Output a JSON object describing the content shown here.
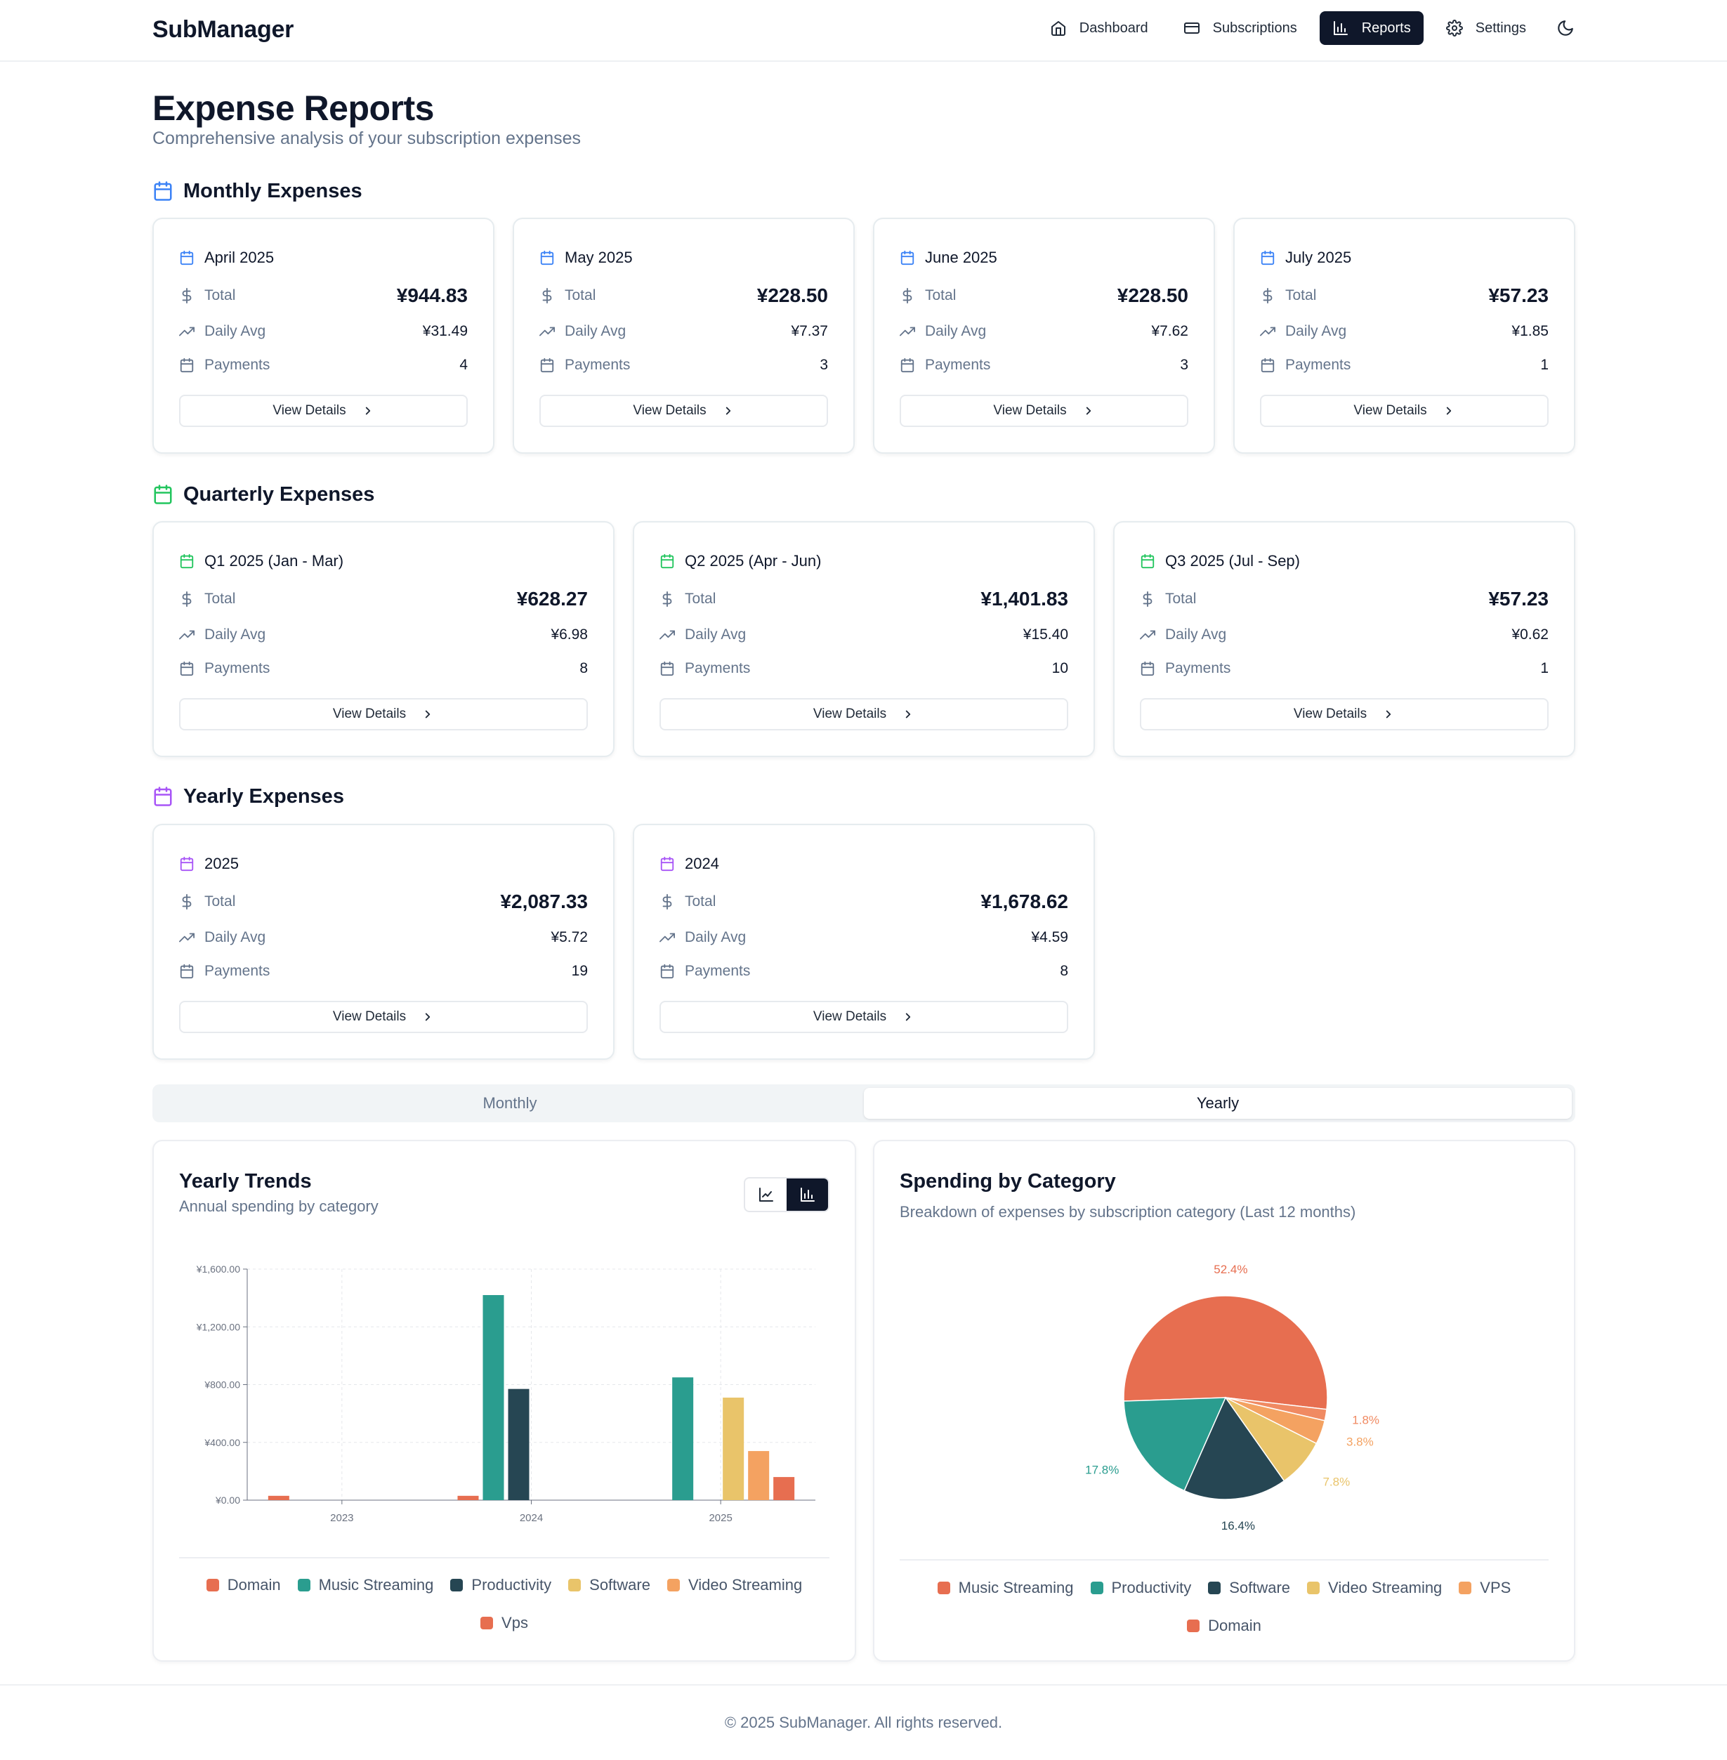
{
  "app": {
    "brand": "SubManager"
  },
  "nav": {
    "items": [
      {
        "label": "Dashboard",
        "icon": "home-icon"
      },
      {
        "label": "Subscriptions",
        "icon": "credit-card-icon"
      },
      {
        "label": "Reports",
        "icon": "bar-chart-icon",
        "active": true
      },
      {
        "label": "Settings",
        "icon": "gear-icon"
      }
    ],
    "theme_icon": "moon-icon"
  },
  "page": {
    "title": "Expense Reports",
    "subtitle": "Comprehensive analysis of your subscription expenses"
  },
  "labels": {
    "total": "Total",
    "daily_avg": "Daily Avg",
    "payments": "Payments",
    "view_details": "View Details"
  },
  "monthly": {
    "title": "Monthly Expenses",
    "accent": "#3b82f6",
    "cards": [
      {
        "period": "April 2025",
        "total": "¥944.83",
        "daily_avg": "¥31.49",
        "payments": "4"
      },
      {
        "period": "May 2025",
        "total": "¥228.50",
        "daily_avg": "¥7.37",
        "payments": "3"
      },
      {
        "period": "June 2025",
        "total": "¥228.50",
        "daily_avg": "¥7.62",
        "payments": "3"
      },
      {
        "period": "July 2025",
        "total": "¥57.23",
        "daily_avg": "¥1.85",
        "payments": "1"
      }
    ]
  },
  "quarterly": {
    "title": "Quarterly Expenses",
    "accent": "#22c55e",
    "cards": [
      {
        "period": "Q1 2025 (Jan - Mar)",
        "total": "¥628.27",
        "daily_avg": "¥6.98",
        "payments": "8"
      },
      {
        "period": "Q2 2025 (Apr - Jun)",
        "total": "¥1,401.83",
        "daily_avg": "¥15.40",
        "payments": "10"
      },
      {
        "period": "Q3 2025 (Jul - Sep)",
        "total": "¥57.23",
        "daily_avg": "¥0.62",
        "payments": "1"
      }
    ]
  },
  "yearly": {
    "title": "Yearly Expenses",
    "accent": "#a855f7",
    "cards": [
      {
        "period": "2025",
        "total": "¥2,087.33",
        "daily_avg": "¥5.72",
        "payments": "19"
      },
      {
        "period": "2024",
        "total": "¥1,678.62",
        "daily_avg": "¥4.59",
        "payments": "8"
      }
    ]
  },
  "tabs": [
    {
      "label": "Monthly",
      "active": false
    },
    {
      "label": "Yearly",
      "active": true
    }
  ],
  "trends": {
    "title": "Yearly Trends",
    "subtitle": "Annual spending by category",
    "toggle": [
      {
        "icon": "line-chart-icon",
        "active": false
      },
      {
        "icon": "bar-chart-icon",
        "active": true
      }
    ]
  },
  "category": {
    "title": "Spending by Category",
    "subtitle": "Breakdown of expenses by subscription category (Last 12 months)"
  },
  "colors": {
    "Domain": "#e76e50",
    "Music Streaming": "#2a9d8f",
    "Productivity": "#264653",
    "Software": "#e9c46a",
    "Video Streaming": "#f4a261",
    "Vps": "#e76e50"
  },
  "chart_data": [
    {
      "type": "bar",
      "categories": [
        "2023",
        "2024",
        "2025"
      ],
      "ylim": [
        0,
        1600
      ],
      "yticks": [
        "¥0.00",
        "¥400.00",
        "¥800.00",
        "¥1,200.00",
        "¥1,600.00"
      ],
      "series": [
        {
          "name": "Domain",
          "values": [
            30,
            30,
            0
          ]
        },
        {
          "name": "Music Streaming",
          "values": [
            0,
            1420,
            850
          ]
        },
        {
          "name": "Productivity",
          "values": [
            0,
            770,
            0
          ]
        },
        {
          "name": "Software",
          "values": [
            0,
            0,
            710
          ]
        },
        {
          "name": "Video Streaming",
          "values": [
            0,
            0,
            340
          ]
        },
        {
          "name": "Vps",
          "values": [
            0,
            0,
            160
          ]
        }
      ],
      "legend": [
        "Domain",
        "Music Streaming",
        "Productivity",
        "Software",
        "Video Streaming",
        "Vps"
      ],
      "grid": true,
      "legend_position": "bottom"
    },
    {
      "type": "pie",
      "slices": [
        {
          "name": "Music Streaming",
          "label": "52.4%",
          "value": 52.4,
          "color": "#e76e50"
        },
        {
          "name": "VPS",
          "label": "1.8%",
          "value": 1.8,
          "color": "#f08a62"
        },
        {
          "name": "Domain",
          "label": "3.8%",
          "value": 3.8,
          "color": "#f4a261"
        },
        {
          "name": "Video Streaming",
          "label": "7.8%",
          "value": 7.8,
          "color": "#e9c46a"
        },
        {
          "name": "Software",
          "label": "16.4%",
          "value": 16.4,
          "color": "#264653"
        },
        {
          "name": "Productivity",
          "label": "17.8%",
          "value": 17.8,
          "color": "#2a9d8f"
        }
      ],
      "legend": [
        {
          "name": "Music Streaming",
          "color": "#e76e50"
        },
        {
          "name": "Productivity",
          "color": "#2a9d8f"
        },
        {
          "name": "Software",
          "color": "#264653"
        },
        {
          "name": "Video Streaming",
          "color": "#e9c46a"
        },
        {
          "name": "VPS",
          "color": "#f4a261"
        },
        {
          "name": "Domain",
          "color": "#e76e50"
        }
      ],
      "legend_position": "bottom"
    }
  ],
  "footer": {
    "text": "© 2025 SubManager. All rights reserved."
  }
}
